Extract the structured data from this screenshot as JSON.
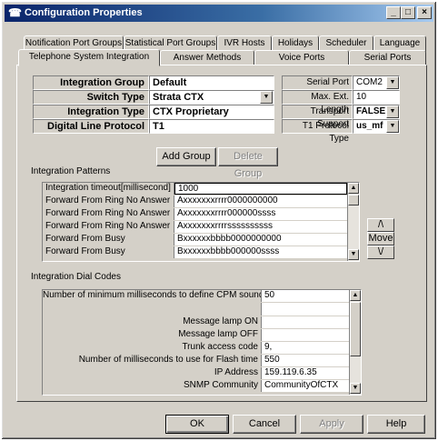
{
  "window": {
    "title": "Configuration Properties",
    "controls": {
      "minimize": "_",
      "maximize": "□",
      "close": "×"
    }
  },
  "tabs_row1": [
    "Notification Port Groups",
    "Statistical Port Groups",
    "IVR Hosts",
    "Holidays",
    "Scheduler",
    "Language"
  ],
  "tabs_row2": [
    "Telephone System Integration",
    "Answer Methods",
    "Voice Ports",
    "Serial Ports"
  ],
  "active_tab": "Telephone System Integration",
  "settings": {
    "integration_group_name": {
      "label": "Integration Group Name",
      "value": "Default"
    },
    "switch_type": {
      "label": "Switch Type",
      "value": "Strata CTX"
    },
    "integration_type": {
      "label": "Integration Type",
      "value": "CTX Proprietary"
    },
    "digital_line_protocol": {
      "label": "Digital Line Protocol",
      "value": "T1"
    },
    "serial_port": {
      "label": "Serial Port",
      "value": "COM2"
    },
    "max_ext_length": {
      "label": "Max. Ext. Length",
      "value": "10"
    },
    "transport_support": {
      "label": "Transport Support",
      "value": "FALSE"
    },
    "t1_protocol_type": {
      "label": "T1 Protocol Type",
      "value": "us_mf"
    }
  },
  "buttons": {
    "add_group": "Add Group",
    "delete_group": "Delete Group",
    "ok": "OK",
    "cancel": "Cancel",
    "apply": "Apply",
    "help": "Help"
  },
  "integration_patterns": {
    "section_label": "Integration Patterns",
    "rows": [
      {
        "name": "Integration timeout[millisecond]",
        "value": "1000"
      },
      {
        "name": "Forward From Ring No Answer",
        "value": "Axxxxxxxrrrr0000000000"
      },
      {
        "name": "Forward From Ring No Answer",
        "value": "Axxxxxxxrrrr000000ssss"
      },
      {
        "name": "Forward From Ring No Answer",
        "value": "Axxxxxxxrrrrssssssssss"
      },
      {
        "name": "Forward From Busy",
        "value": "Bxxxxxxbbbb0000000000"
      },
      {
        "name": "Forward From Busy",
        "value": "Bxxxxxxbbbb000000ssss"
      }
    ],
    "move": {
      "up": "/\\",
      "label": "Move",
      "down": "\\/"
    }
  },
  "integration_dial_codes": {
    "section_label": "Integration Dial Codes",
    "rows": [
      {
        "name": "Number of minimum milliseconds to define CPM sound",
        "value": "50"
      },
      {
        "name": "",
        "value": ""
      },
      {
        "name": "Message lamp ON",
        "value": ""
      },
      {
        "name": "Message lamp OFF",
        "value": ""
      },
      {
        "name": "Trunk access code",
        "value": "9,"
      },
      {
        "name": "Number of milliseconds to use for Flash time",
        "value": "550"
      },
      {
        "name": "IP Address",
        "value": "159.119.6.35"
      },
      {
        "name": "SNMP Community",
        "value": "CommunityOfCTX"
      }
    ]
  },
  "icons": {
    "app": "phone-icon",
    "dropdown": "▼",
    "scroll_up": "▲",
    "scroll_down": "▼"
  },
  "colors": {
    "title_start": "#0a246a",
    "title_end": "#a6caf0",
    "face": "#d4d0c8"
  }
}
